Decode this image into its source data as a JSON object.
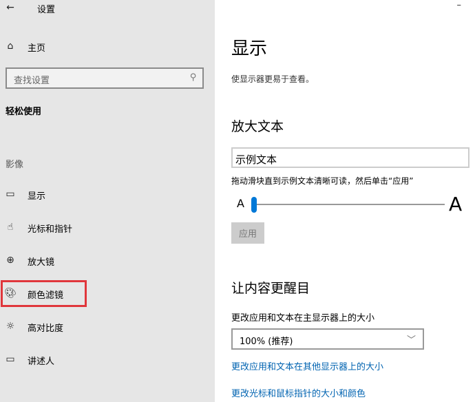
{
  "window": {
    "title": "设置",
    "minimize": "–"
  },
  "sidebar": {
    "home": "主页",
    "search_placeholder": "查找设置",
    "section": "轻松使用",
    "group": "影像",
    "items": [
      {
        "label": "显示",
        "icon": "monitor-icon"
      },
      {
        "label": "光标和指针",
        "icon": "pointer-icon"
      },
      {
        "label": "放大镜",
        "icon": "magnifier-icon"
      },
      {
        "label": "颜色滤镜",
        "icon": "palette-icon",
        "highlighted": true
      },
      {
        "label": "高对比度",
        "icon": "sun-icon"
      },
      {
        "label": "讲述人",
        "icon": "narrator-icon"
      }
    ],
    "highlight_color": "#e0363b"
  },
  "main": {
    "title": "显示",
    "subtitle": "使显示器更易于查看。",
    "enlarge": {
      "heading": "放大文本",
      "sample": "示例文本",
      "instruction": "拖动滑块直到示例文本清晰可读，然后单击“应用”",
      "small_a": "A",
      "large_a": "A",
      "slider_value": 0,
      "apply": "应用"
    },
    "prominent": {
      "heading": "让内容更醒目",
      "size_label": "更改应用和文本在主显示器上的大小",
      "size_value": "100% (推荐)",
      "link1": "更改应用和文本在其他显示器上的大小",
      "link2": "更改光标和鼠标指针的大小和颜色"
    },
    "accent": "#0078d7"
  }
}
